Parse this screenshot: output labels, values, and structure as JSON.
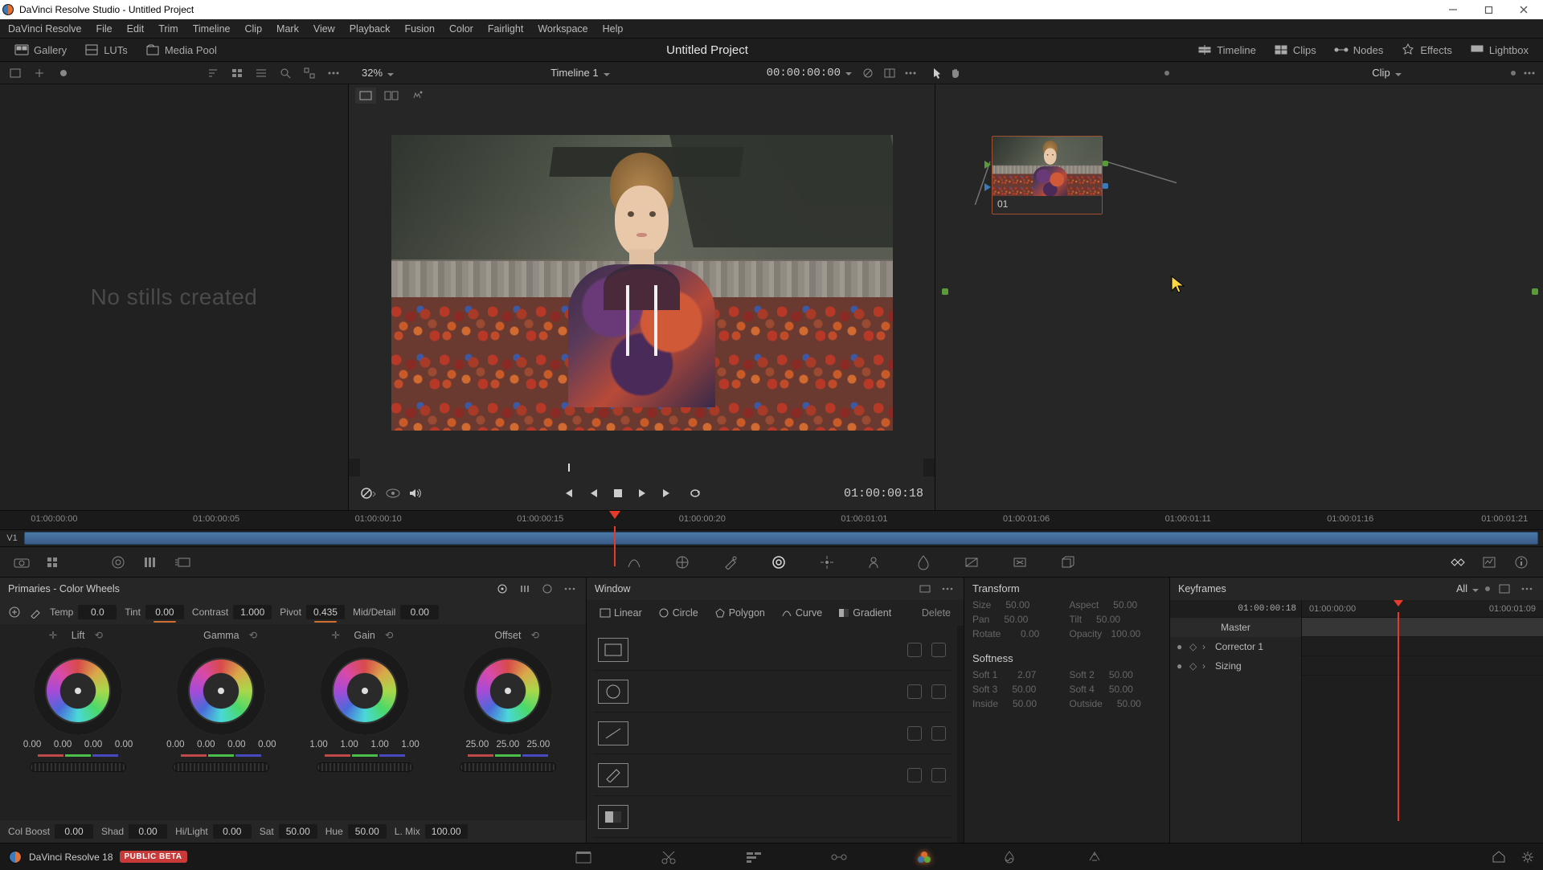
{
  "app": {
    "title_prefix": "DaVinci Resolve Studio",
    "title_project": "Untitled Project",
    "version_label": "DaVinci Resolve 18",
    "beta_label": "PUBLIC BETA"
  },
  "menus": [
    "DaVinci Resolve",
    "File",
    "Edit",
    "Trim",
    "Timeline",
    "Clip",
    "Mark",
    "View",
    "Playback",
    "Fusion",
    "Color",
    "Fairlight",
    "Workspace",
    "Help"
  ],
  "top_tabs": {
    "left": [
      {
        "name": "gallery",
        "label": "Gallery"
      },
      {
        "name": "luts",
        "label": "LUTs"
      },
      {
        "name": "media-pool",
        "label": "Media Pool"
      }
    ],
    "center_title": "Untitled Project",
    "right": [
      {
        "name": "timeline",
        "label": "Timeline"
      },
      {
        "name": "clips",
        "label": "Clips"
      },
      {
        "name": "nodes",
        "label": "Nodes"
      },
      {
        "name": "effects",
        "label": "Effects"
      },
      {
        "name": "lightbox",
        "label": "Lightbox"
      }
    ]
  },
  "secbar": {
    "zoom": "32%",
    "timeline_name": "Timeline 1",
    "timecode": "00:00:00:00",
    "node_mode": "Clip"
  },
  "gallery": {
    "empty_text": "No stills created"
  },
  "viewer": {
    "current_tc": "01:00:00:18"
  },
  "nodes": {
    "node_label": "01"
  },
  "ruler_ticks": [
    "01:00:00:00",
    "01:00:00:05",
    "01:00:00:10",
    "01:00:00:15",
    "01:00:00:20",
    "01:00:01:01",
    "01:00:01:06",
    "01:00:01:11",
    "01:00:01:16",
    "01:00:01:21"
  ],
  "track_label": "V1",
  "playhead_pct": 39.5,
  "primaries": {
    "title": "Primaries - Color Wheels",
    "top": {
      "temp": {
        "label": "Temp",
        "value": "0.0"
      },
      "tint": {
        "label": "Tint",
        "value": "0.00"
      },
      "contrast": {
        "label": "Contrast",
        "value": "1.000"
      },
      "pivot": {
        "label": "Pivot",
        "value": "0.435"
      },
      "middetail": {
        "label": "Mid/Detail",
        "value": "0.00"
      }
    },
    "wheels": {
      "lift": {
        "label": "Lift",
        "vals": [
          "0.00",
          "0.00",
          "0.00",
          "0.00"
        ]
      },
      "gamma": {
        "label": "Gamma",
        "vals": [
          "0.00",
          "0.00",
          "0.00",
          "0.00"
        ]
      },
      "gain": {
        "label": "Gain",
        "vals": [
          "1.00",
          "1.00",
          "1.00",
          "1.00"
        ]
      },
      "offset": {
        "label": "Offset",
        "vals": [
          "25.00",
          "25.00",
          "25.00"
        ]
      }
    },
    "bot": {
      "colboost": {
        "label": "Col Boost",
        "value": "0.00"
      },
      "shad": {
        "label": "Shad",
        "value": "0.00"
      },
      "hilight": {
        "label": "Hi/Light",
        "value": "0.00"
      },
      "sat": {
        "label": "Sat",
        "value": "50.00"
      },
      "hue": {
        "label": "Hue",
        "value": "50.00"
      },
      "lmix": {
        "label": "L. Mix",
        "value": "100.00"
      }
    }
  },
  "window": {
    "title": "Window",
    "shapes": {
      "linear": "Linear",
      "circle": "Circle",
      "polygon": "Polygon",
      "curve": "Curve",
      "gradient": "Gradient",
      "delete": "Delete"
    }
  },
  "transform": {
    "title": "Transform",
    "size": {
      "label": "Size",
      "value": "50.00"
    },
    "aspect": {
      "label": "Aspect",
      "value": "50.00"
    },
    "pan": {
      "label": "Pan",
      "value": "50.00"
    },
    "tilt": {
      "label": "Tilt",
      "value": "50.00"
    },
    "rotate": {
      "label": "Rotate",
      "value": "0.00"
    },
    "opacity": {
      "label": "Opacity",
      "value": "100.00"
    },
    "softness_title": "Softness",
    "soft1": {
      "label": "Soft 1",
      "value": "2.07"
    },
    "soft2": {
      "label": "Soft 2",
      "value": "50.00"
    },
    "soft3": {
      "label": "Soft 3",
      "value": "50.00"
    },
    "soft4": {
      "label": "Soft 4",
      "value": "50.00"
    },
    "inside": {
      "label": "Inside",
      "value": "50.00"
    },
    "outside": {
      "label": "Outside",
      "value": "50.00"
    }
  },
  "keyframes": {
    "title": "Keyframes",
    "mode": "All",
    "ticks": [
      "01:00:00:18",
      "01:00:00:00",
      "01:00:01:09"
    ],
    "master": "Master",
    "rows": [
      "Corrector 1",
      "Sizing"
    ],
    "playhead_pct": 38
  }
}
